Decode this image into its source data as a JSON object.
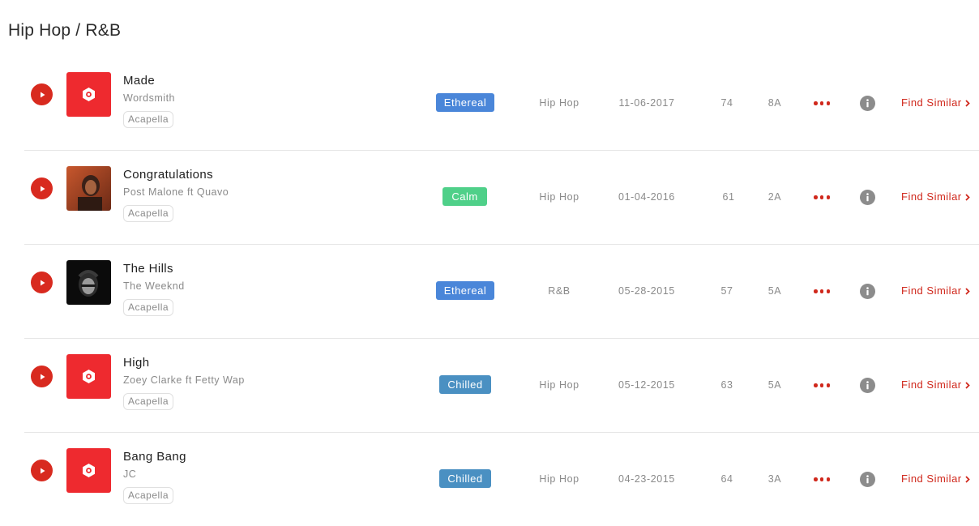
{
  "page": {
    "title": "Hip Hop / R&B"
  },
  "colors": {
    "accent_red": "#d82a1f",
    "mood_ethereal": "#4a86d9",
    "mood_calm": "#4fd089",
    "mood_chilled": "#4a90c2",
    "text_muted": "#8a8a8a"
  },
  "tracks": [
    {
      "title": "Made",
      "artist": "Wordsmith",
      "tag": "Acapella",
      "mood": "Ethereal",
      "genre": "Hip Hop",
      "date": "11-06-2017",
      "bpm": "74",
      "key": "8A",
      "find_label": "Find Similar"
    },
    {
      "title": "Congratulations",
      "artist": "Post Malone ft Quavo",
      "tag": "Acapella",
      "mood": "Calm",
      "genre": "Hip Hop",
      "date": "01-04-2016",
      "bpm": "61",
      "key": "2A",
      "find_label": "Find Similar"
    },
    {
      "title": "The Hills",
      "artist": "The Weeknd",
      "tag": "Acapella",
      "mood": "Ethereal",
      "genre": "R&B",
      "date": "05-28-2015",
      "bpm": "57",
      "key": "5A",
      "find_label": "Find Similar"
    },
    {
      "title": "High",
      "artist": "Zoey Clarke ft Fetty Wap",
      "tag": "Acapella",
      "mood": "Chilled",
      "genre": "Hip Hop",
      "date": "05-12-2015",
      "bpm": "63",
      "key": "5A",
      "find_label": "Find Similar"
    },
    {
      "title": "Bang Bang",
      "artist": "JC",
      "tag": "Acapella",
      "mood": "Chilled",
      "genre": "Hip Hop",
      "date": "04-23-2015",
      "bpm": "64",
      "key": "3A",
      "find_label": "Find Similar"
    }
  ],
  "icons": {
    "play": "play-icon",
    "cover_placeholder": "hexagon-logo-icon",
    "more": "ellipsis-icon",
    "info": "info-icon",
    "chevron": "chevron-right-icon"
  }
}
